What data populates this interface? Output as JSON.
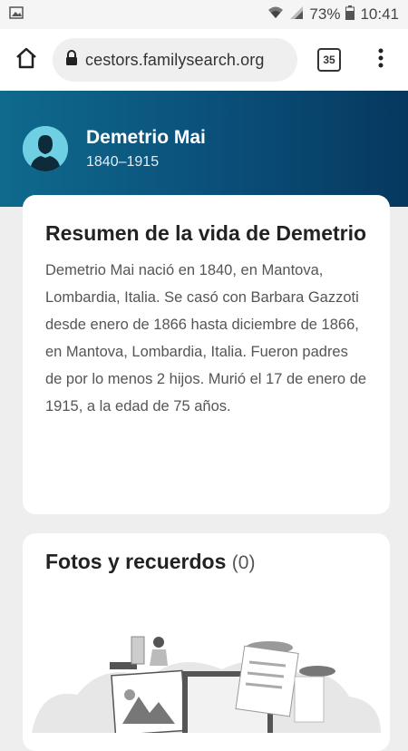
{
  "status_bar": {
    "battery": "73%",
    "time": "10:41"
  },
  "browser": {
    "url": "cestors.familysearch.org",
    "tab_count": "35"
  },
  "person": {
    "name": "Demetrio Mai",
    "dates": "1840–1915"
  },
  "summary": {
    "title": "Resumen de la vida de Demetrio",
    "body": "Demetrio Mai nació en 1840, en Mantova, Lombardia, Italia. Se casó con Barbara Gazzoti desde enero de 1866 hasta diciembre de 1866, en Mantova, Lombardia, Italia. Fueron padres de por lo menos 2 hijos. Murió el 17 de enero de 1915, a la edad de 75 años."
  },
  "photos": {
    "title": "Fotos y recuerdos",
    "count": "(0)"
  },
  "icons": {
    "status_left": "image-icon",
    "wifi": "wifi-icon",
    "signal": "signal-icon",
    "battery": "battery-icon",
    "home": "home-icon",
    "lock": "lock-icon",
    "menu": "more-vert-icon",
    "avatar": "person-silhouette-icon"
  }
}
